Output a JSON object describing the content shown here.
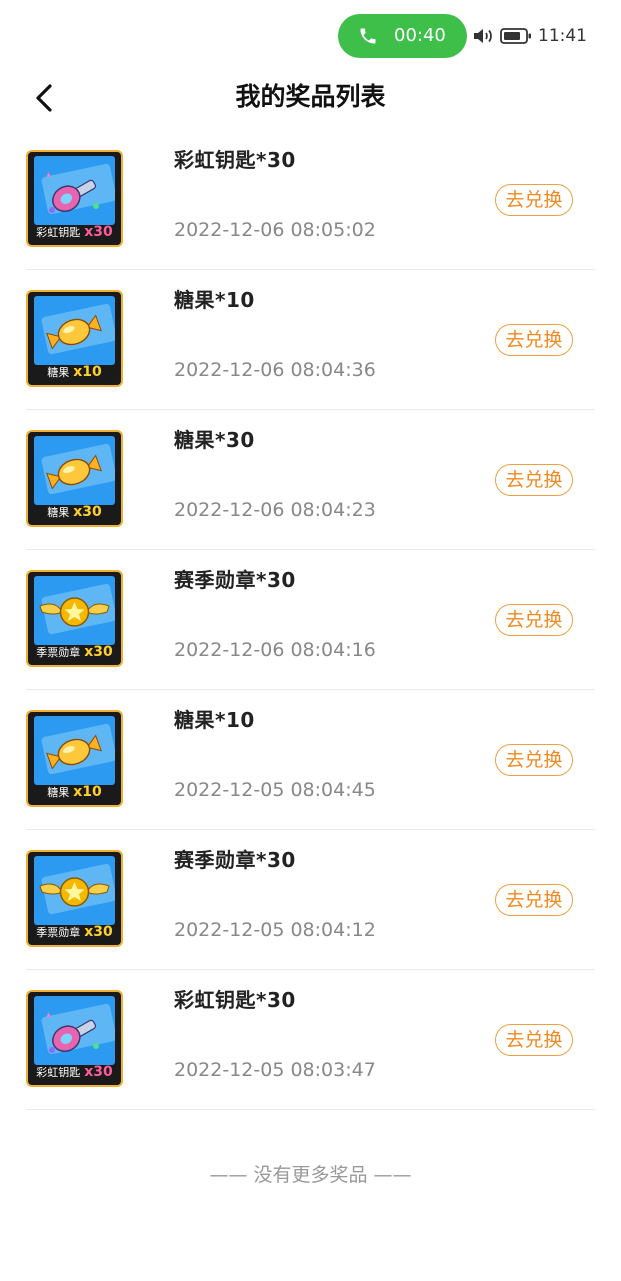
{
  "status_bar": {
    "call_timer": "00:40",
    "time": "11:41",
    "call_color": "#3dbf4a"
  },
  "header": {
    "title": "我的奖品列表"
  },
  "prizes": [
    {
      "name": "彩虹钥匙*30",
      "time": "2022-12-06 08:05:02",
      "icon": "rainbow-key-icon",
      "caption": "彩虹钥匙",
      "qty": "x30",
      "action": "去兑换"
    },
    {
      "name": "糖果*10",
      "time": "2022-12-06 08:04:36",
      "icon": "candy-icon",
      "caption": "糖果",
      "qty": "x10",
      "action": "去兑换"
    },
    {
      "name": "糖果*30",
      "time": "2022-12-06 08:04:23",
      "icon": "candy-icon",
      "caption": "糖果",
      "qty": "x30",
      "action": "去兑换"
    },
    {
      "name": "赛季勋章*30",
      "time": "2022-12-06 08:04:16",
      "icon": "season-medal-icon",
      "caption": "季票勋章",
      "qty": "x30",
      "action": "去兑换"
    },
    {
      "name": "糖果*10",
      "time": "2022-12-05 08:04:45",
      "icon": "candy-icon",
      "caption": "糖果",
      "qty": "x10",
      "action": "去兑换"
    },
    {
      "name": "赛季勋章*30",
      "time": "2022-12-05 08:04:12",
      "icon": "season-medal-icon",
      "caption": "季票勋章",
      "qty": "x30",
      "action": "去兑换"
    },
    {
      "name": "彩虹钥匙*30",
      "time": "2022-12-05 08:03:47",
      "icon": "rainbow-key-icon",
      "caption": "彩虹钥匙",
      "qty": "x30",
      "action": "去兑换"
    }
  ],
  "footer": {
    "text": "—— 没有更多奖品 ——"
  },
  "colors": {
    "accent": "#f08a20",
    "thumb_bg": "#2b9af0"
  }
}
